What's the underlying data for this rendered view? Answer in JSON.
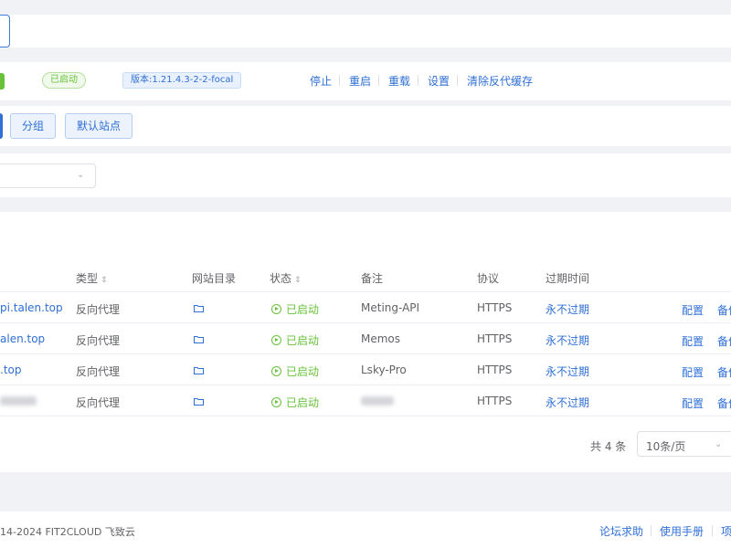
{
  "status_bar": {
    "status_label": "已启动",
    "version_label": "版本:1.21.4.3-2-2-focal",
    "actions": [
      "停止",
      "重启",
      "重载",
      "设置",
      "清除反代缓存"
    ]
  },
  "toolbar": {
    "group_label": "分组",
    "default_site_label": "默认站点"
  },
  "table": {
    "headers": {
      "type": "类型",
      "dir": "网站目录",
      "status": "状态",
      "remark": "备注",
      "protocol": "协议",
      "expire": "过期时间"
    },
    "rows": [
      {
        "domain": "pi.talen.top",
        "type": "反向代理",
        "status": "已启动",
        "remark": "Meting-API",
        "protocol": "HTTPS",
        "expire": "永不过期",
        "config": "配置",
        "more": "备份"
      },
      {
        "domain": "alen.top",
        "type": "反向代理",
        "status": "已启动",
        "remark": "Memos",
        "protocol": "HTTPS",
        "expire": "永不过期",
        "config": "配置",
        "more": "备份"
      },
      {
        "domain": ".top",
        "type": "反向代理",
        "status": "已启动",
        "remark": "Lsky-Pro",
        "protocol": "HTTPS",
        "expire": "永不过期",
        "config": "配置",
        "more": "备份"
      },
      {
        "domain": "",
        "type": "反向代理",
        "status": "已启动",
        "remark": "",
        "protocol": "HTTPS",
        "expire": "永不过期",
        "config": "配置",
        "more": "备份"
      }
    ]
  },
  "pagination": {
    "total": "共 4 条",
    "page_size": "10条/页"
  },
  "footer": {
    "copyright": "14-2024 FIT2CLOUD 飞致云",
    "links": [
      "论坛求助",
      "使用手册",
      "项"
    ]
  },
  "colors": {
    "accent": "#2f6fd6",
    "success": "#67c23a",
    "background": "#f0f2f5"
  }
}
